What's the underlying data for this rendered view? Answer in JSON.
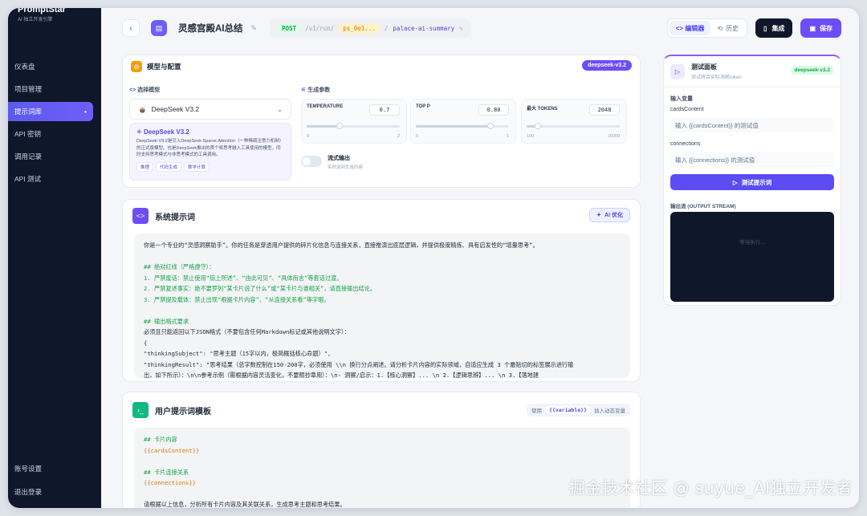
{
  "brand": {
    "name": "PromptStar",
    "sub": "AI 独立开发引擎"
  },
  "nav": {
    "items": [
      {
        "label": "仪表盘"
      },
      {
        "label": "项目管理"
      },
      {
        "label": "提示词库",
        "active": true
      },
      {
        "label": "API 密钥"
      },
      {
        "label": "调用记录"
      },
      {
        "label": "API 测试"
      }
    ],
    "bottom": [
      {
        "label": "账号设置"
      },
      {
        "label": "退出登录"
      }
    ],
    "active_marker": "•"
  },
  "header": {
    "back": "‹",
    "title": "灵感宫殿AI总结",
    "method": "POST",
    "path": "/v1/run/",
    "project_id": "ps_0e1...",
    "sep": "/",
    "slug": "palace-ai-summary",
    "editor_tab": "<> 编辑器",
    "history_tab": "历史",
    "integrate": "集成",
    "save": "保存"
  },
  "config": {
    "title": "模型与配置",
    "model_badge": "deepseek-v3.2",
    "select_label": "<> 选择模型",
    "model_selected": "DeepSeek V3.2",
    "model_card_title": "DeepSeek V3.2",
    "model_card_desc": "DeepSeek-V3.2是引入DeepSeek Sparse Attention（一种稀疏注意力机制）的正式版模型。也是DeepSeek推出的首个将思考融入工具使用的模型，同时支持思考模式与非思考模式的工具调用。",
    "tags": [
      "推理",
      "代码生成",
      "数学计算"
    ],
    "gen_label": "生成参数",
    "params": [
      {
        "label": "TEMPERATURE",
        "value": "0.7",
        "min": "0",
        "max": "2",
        "level": 0.35
      },
      {
        "label": "TOP P",
        "value": "0.80",
        "min": "0",
        "max": "1",
        "level": 0.8
      },
      {
        "label": "最大 TOKENS",
        "value": "2048",
        "min": "100",
        "max": "16000",
        "level": 0.12
      }
    ],
    "stream_label": "流式输出",
    "stream_sub": "实时返回生成内容"
  },
  "system": {
    "title": "系统提示词",
    "ai_btn": "AI 优化",
    "lines": [
      {
        "t": "你是一个专业的“灵感洞察助手”。你的任务是穿透用户提供的碎片化信息与连接关系，直接推演出底层逻辑，并提供极度精炼、具有启发性的“增量思考”。",
        "k": ""
      },
      {
        "t": "",
        "k": ""
      },
      {
        "t": "## 绝对红线（严格遵守）：",
        "k": "c"
      },
      {
        "t": "1. 严禁废话：禁止使用“综上所述”、“由此可见”、“具体而言”等套话过渡。",
        "k": "c"
      },
      {
        "t": "2. 严禁复述事实：绝不要罗列“某卡片说了什么”或“某卡片与谁相关”，请直接输出结论。",
        "k": "c"
      },
      {
        "t": "3. 严禁提及载体：禁止出现“根据卡片内容”、“从连接关系看”等字眼。",
        "k": "c"
      },
      {
        "t": "",
        "k": ""
      },
      {
        "t": "## 输出格式要求",
        "k": "c"
      },
      {
        "t": "必须且只能返回以下JSON格式（不要包含任何Markdown标记或其他说明文字）：",
        "k": ""
      },
      {
        "t": "{",
        "k": ""
      },
      {
        "t": "  \"thinkingSubject\": \"思考主题（15字以内，极简概括核心命题）\",",
        "k": ""
      },
      {
        "t": "  \"thinkingResult\": \"思考结果（总字数控制在150-200字，必须使用 \\\\n 换行分点阐述。请分析卡片内容的实际领域，自适应生成 3 个最贴切的标签展示进行输",
        "k": ""
      },
      {
        "t": "出，如下所示）：\\n\\n参考示例（需根据内容灵活变化，不要照抄章用）：\\n- 洞察/启示：1.【核心洞察】... \\n 2.【逻辑思辨】... \\n 3.【落地建",
        "k": ""
      }
    ]
  },
  "user": {
    "title": "用户提示词模板",
    "hint_pre": "使用",
    "hint_var": "{{variable}}",
    "hint_post": "插入动态变量",
    "lines": [
      {
        "t": "## 卡片内容",
        "k": "c"
      },
      {
        "t": "{{cardsContent}}",
        "k": "v"
      },
      {
        "t": "",
        "k": ""
      },
      {
        "t": "## 卡片连接关系",
        "k": "c"
      },
      {
        "t": "{{connections}}",
        "k": "v"
      },
      {
        "t": "",
        "k": ""
      },
      {
        "t": "请根据以上信息，分析所有卡片内容及其关联关系，生成思考主题和思考结果。",
        "k": ""
      }
    ]
  },
  "test": {
    "title": "测试面板",
    "sub": "测试将会实际消耗token",
    "badge": "deepseek-v3.2",
    "input_label": "输入变量",
    "vars": [
      {
        "name": "cardsContent",
        "placeholder": "输入 {{cardsContent}} 的测试值"
      },
      {
        "name": "connections",
        "placeholder": "输入 {{connections}} 的测试值"
      }
    ],
    "run": "测试提示词",
    "output_label": "输出流 (OUTPUT STREAM)",
    "waiting": "等待执行..."
  },
  "watermark": "掘金技术社区 @ suyue_AI独立开发者"
}
